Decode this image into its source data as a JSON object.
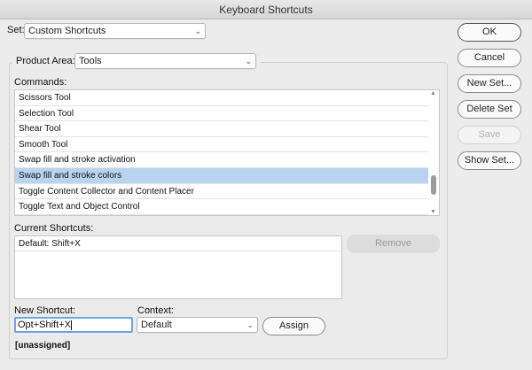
{
  "window": {
    "title": "Keyboard Shortcuts"
  },
  "set": {
    "label": "Set:",
    "value": "Custom Shortcuts"
  },
  "product_area": {
    "label": "Product Area:",
    "value": "Tools"
  },
  "commands": {
    "label": "Commands:",
    "items": [
      {
        "label": "Scissors Tool",
        "selected": false
      },
      {
        "label": "Selection Tool",
        "selected": false
      },
      {
        "label": "Shear Tool",
        "selected": false
      },
      {
        "label": "Smooth Tool",
        "selected": false
      },
      {
        "label": "Swap fill and stroke activation",
        "selected": false
      },
      {
        "label": "Swap fill and stroke colors",
        "selected": true
      },
      {
        "label": "Toggle Content Collector and Content Placer",
        "selected": false
      },
      {
        "label": "Toggle Text and Object Control",
        "selected": false
      }
    ]
  },
  "current_shortcuts": {
    "label": "Current Shortcuts:",
    "items": [
      "Default: Shift+X"
    ],
    "remove_label": "Remove"
  },
  "new_shortcut": {
    "label": "New Shortcut:",
    "value": "Opt+Shift+X",
    "status": "[unassigned]"
  },
  "context": {
    "label": "Context:",
    "value": "Default"
  },
  "assign_label": "Assign",
  "buttons": {
    "ok": "OK",
    "cancel": "Cancel",
    "new_set": "New Set...",
    "delete_set": "Delete Set",
    "save": "Save",
    "show_set": "Show Set..."
  },
  "colors": {
    "selection": "#b9d4ef",
    "focus_ring": "#6ea5e6"
  }
}
